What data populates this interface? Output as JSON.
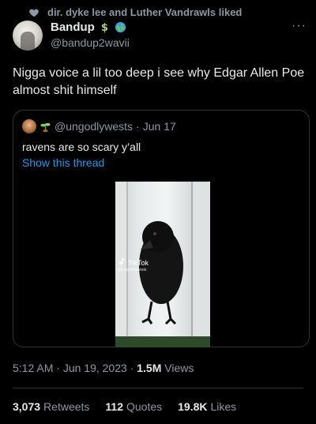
{
  "social_context": {
    "text": "dir. dyke lee and Luther Vandrawls liked",
    "icon": "heart-icon"
  },
  "author": {
    "display_name": "Bandup",
    "handle": "@bandup2wavii",
    "badges": [
      "dollar-sign-icon",
      "globe-icon"
    ]
  },
  "more_label": "···",
  "tweet": {
    "text": "Nigga voice a lil too deep i see why Edgar Allen Poe almost shit himself"
  },
  "quoted_tweet": {
    "handle": "@ungodlywests",
    "separator": "·",
    "date": "Jun 17",
    "text": "ravens are so scary y’all",
    "show_thread": "Show this thread",
    "media": {
      "type": "video",
      "description_icon": "tiktok-icon",
      "watermark": "TikTok",
      "watermark_sub": "@ungodlywests"
    }
  },
  "meta": {
    "time": "5:12 AM",
    "dot": "·",
    "date": "Jun 19, 2023",
    "views_count": "1.5M",
    "views_label": "Views"
  },
  "stats": {
    "retweets_count": "3,073",
    "retweets_label": "Retweets",
    "quotes_count": "112",
    "quotes_label": "Quotes",
    "likes_count": "19.8K",
    "likes_label": "Likes"
  },
  "colors": {
    "background": "#000000",
    "text": "#e7e9ea",
    "muted": "#8b98a5",
    "link": "#1d9bf0",
    "border": "#2f3336"
  }
}
